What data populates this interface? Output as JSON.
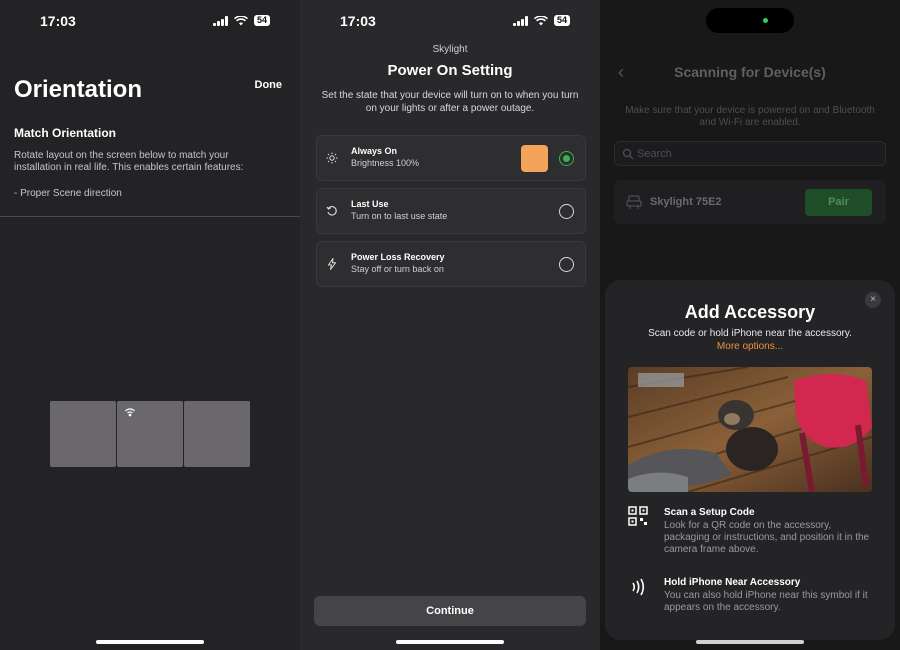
{
  "status_bar": {
    "time": "17:03",
    "battery": "54"
  },
  "orientation": {
    "title": "Orientation",
    "done_label": "Done",
    "subtitle": "Match Orientation",
    "description": "Rotate layout on the screen below to match your installation in real life. This enables certain features:",
    "feature": "- Proper Scene direction"
  },
  "power_on": {
    "brand": "Skylight",
    "title": "Power On Setting",
    "description": "Set the state that your device will turn on to when you turn on your lights or after a power outage.",
    "options": [
      {
        "title": "Always On",
        "subtitle": "Brightness 100%",
        "icon": "sun-icon",
        "selected": true,
        "swatch_color": "#f4a35b"
      },
      {
        "title": "Last Use",
        "subtitle": "Turn on to last use state",
        "icon": "history-icon",
        "selected": false
      },
      {
        "title": "Power Loss Recovery",
        "subtitle": "Stay off or turn back on",
        "icon": "lightning-icon",
        "selected": false
      }
    ],
    "continue_label": "Continue"
  },
  "scanning": {
    "title": "Scanning for Device(s)",
    "description": "Make sure that your device is powered on and Bluetooth and Wi-Fi are enabled.",
    "search_placeholder": "Search",
    "device_name": "Skylight 75E2",
    "pair_label": "Pair"
  },
  "add_accessory": {
    "title": "Add Accessory",
    "subtitle": "Scan code or hold iPhone near the accessory.",
    "more_options": "More options...",
    "close_icon": "×",
    "rows": [
      {
        "title": "Scan a Setup Code",
        "description": "Look for a QR code on the accessory, packaging or instructions, and position it in the camera frame above.",
        "icon": "qr-code-icon"
      },
      {
        "title": "Hold iPhone Near Accessory",
        "description": "You can also hold iPhone near this symbol if it appears on the accessory.",
        "icon": "nfc-icon"
      }
    ]
  },
  "colors": {
    "accent_green": "#37b34a",
    "accent_orange": "#f0913a"
  }
}
